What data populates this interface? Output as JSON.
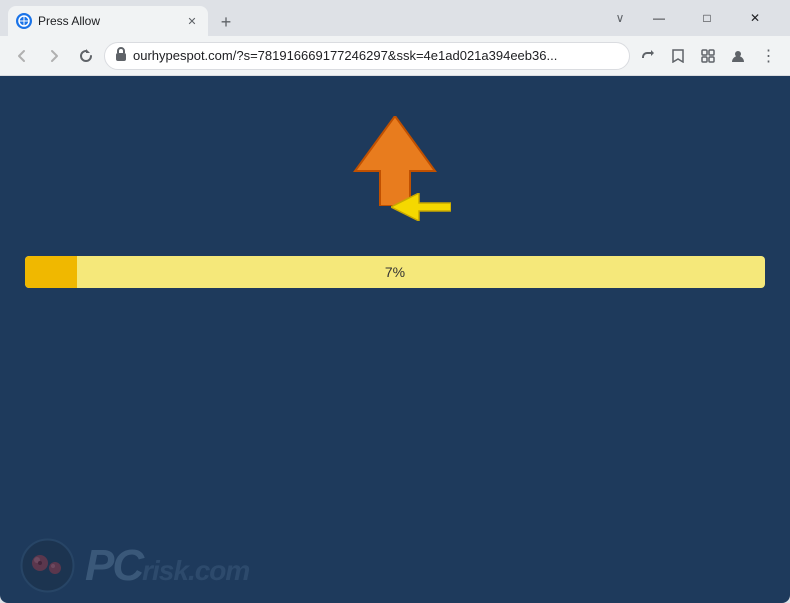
{
  "browser": {
    "tab": {
      "title": "Press Allow",
      "favicon": "🌐"
    },
    "new_tab_icon": "+",
    "window_controls": {
      "minimize": "—",
      "maximize": "□",
      "close": "✕"
    },
    "nav": {
      "back": "←",
      "forward": "→",
      "refresh": "✕"
    },
    "address": {
      "url": "ourhypespot.com/?s=781916669177246297&ssk=4e1ad021a394eeb36...",
      "lock_icon": "🔒"
    },
    "toolbar_icons": {
      "share": "↗",
      "bookmark": "☆",
      "extensions": "□",
      "profile": "👤",
      "menu": "⋮"
    }
  },
  "page": {
    "background_color": "#1e3a5c",
    "progress": {
      "value": 7,
      "label": "7%",
      "fill_color": "#f0b800",
      "bg_color": "#f5e87a"
    },
    "watermark": {
      "text": "PCrisk.com"
    }
  }
}
